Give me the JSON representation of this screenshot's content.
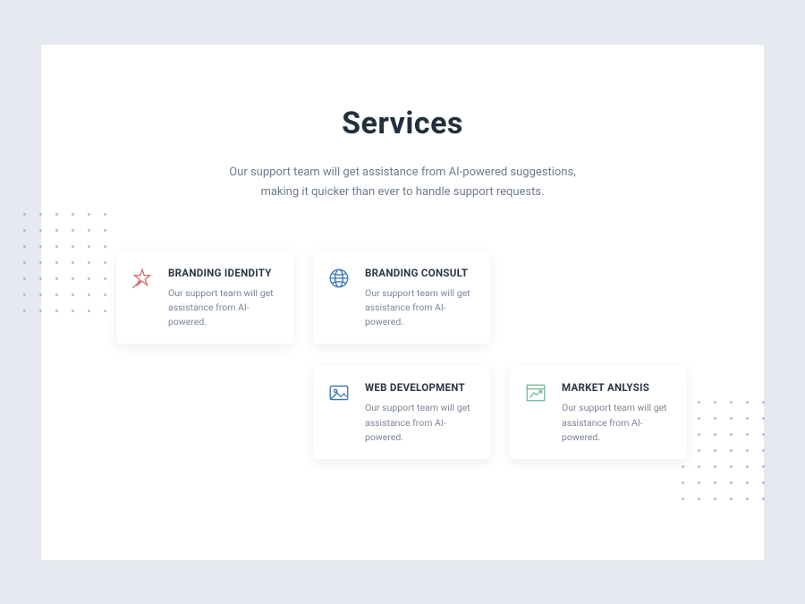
{
  "heading": "Services",
  "subheading": "Our support team will get assistance from AI-powered suggestions, making it quicker than ever to handle support requests.",
  "cards": [
    {
      "title": "BRANDING IDENDITY",
      "desc": "Our support team will get assistance from AI-powered."
    },
    {
      "title": "BRANDING CONSULT",
      "desc": "Our support team will get assistance from AI-powered."
    },
    {
      "title": "WEB DEVELOPMENT",
      "desc": "Our support team will get assistance from AI-powered."
    },
    {
      "title": "MARKET ANLYSIS",
      "desc": "Our support team will get assistance from AI-powered."
    }
  ],
  "colors": {
    "accent_red": "#d96b6b",
    "accent_blue": "#3a73b5",
    "accent_green": "#76b99b",
    "text_dark": "#2a3648",
    "text_muted": "#7a8597"
  }
}
